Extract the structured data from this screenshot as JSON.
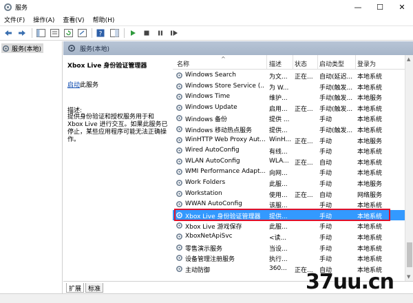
{
  "window": {
    "title": "服务",
    "minimize": "—",
    "maximize": "☐",
    "close": "✕"
  },
  "menu": [
    "文件(F)",
    "操作(A)",
    "查看(V)",
    "帮助(H)"
  ],
  "tree": {
    "root": "服务(本地)"
  },
  "header": {
    "title": "服务(本地)"
  },
  "details": {
    "service_name": "Xbox Live 身份验证管理器",
    "start_link": "启动",
    "start_suffix": "此服务",
    "desc_label": "描述:",
    "desc_text": "提供身份验证和授权服务用于和 Xbox Live 进行交互。如果此服务已停止，某些应用程序可能无法正确操作。"
  },
  "columns": {
    "name": "名称",
    "desc": "描述",
    "status": "状态",
    "startup": "启动类型",
    "logon": "登录为",
    "sort": "^"
  },
  "rows": [
    {
      "name": "Windows Search",
      "desc": "为文...",
      "status": "正在...",
      "startup": "自动(延迟...",
      "logon": "本地系统"
    },
    {
      "name": "Windows Store Service (...",
      "desc": "为 W...",
      "status": "",
      "startup": "手动(触发...",
      "logon": "本地系统"
    },
    {
      "name": "Windows Time",
      "desc": "维护...",
      "status": "",
      "startup": "手动(触发...",
      "logon": "本地服务"
    },
    {
      "name": "Windows Update",
      "desc": "启用...",
      "status": "正在...",
      "startup": "手动(触发...",
      "logon": "本地系统"
    },
    {
      "name": "Windows 备份",
      "desc": "提供 ...",
      "status": "",
      "startup": "手动",
      "logon": "本地系统"
    },
    {
      "name": "Windows 移动热点服务",
      "desc": "提供...",
      "status": "",
      "startup": "手动(触发...",
      "logon": "本地系统"
    },
    {
      "name": "WinHTTP Web Proxy Aut...",
      "desc": "WinH...",
      "status": "正在...",
      "startup": "手动",
      "logon": "本地服务"
    },
    {
      "name": "Wired AutoConfig",
      "desc": "有线...",
      "status": "",
      "startup": "手动",
      "logon": "本地系统"
    },
    {
      "name": "WLAN AutoConfig",
      "desc": "WLA...",
      "status": "正在...",
      "startup": "自动",
      "logon": "本地系统"
    },
    {
      "name": "WMI Performance Adapt...",
      "desc": "向网...",
      "status": "",
      "startup": "手动",
      "logon": "本地系统"
    },
    {
      "name": "Work Folders",
      "desc": "此服...",
      "status": "",
      "startup": "手动",
      "logon": "本地服务"
    },
    {
      "name": "Workstation",
      "desc": "使用...",
      "status": "正在...",
      "startup": "自动",
      "logon": "网络服务"
    },
    {
      "name": "WWAN AutoConfig",
      "desc": "该服...",
      "status": "",
      "startup": "手动",
      "logon": "本地系统"
    },
    {
      "name": "Xbox Live 身份验证管理器",
      "desc": "提供...",
      "status": "",
      "startup": "手动",
      "logon": "本地系统"
    },
    {
      "name": "Xbox Live 游戏保存",
      "desc": "此服...",
      "status": "",
      "startup": "手动",
      "logon": "本地系统"
    },
    {
      "name": "XboxNetApiSvc",
      "desc": "<读...",
      "status": "",
      "startup": "手动",
      "logon": "本地系统"
    },
    {
      "name": "零售演示服务",
      "desc": "当设...",
      "status": "",
      "startup": "手动",
      "logon": "本地系统"
    },
    {
      "name": "设备管理注册服务",
      "desc": "执行...",
      "status": "",
      "startup": "手动",
      "logon": "本地系统"
    },
    {
      "name": "主动防御",
      "desc": "360...",
      "status": "正在...",
      "startup": "自动",
      "logon": "本地系统"
    }
  ],
  "selected_row": 13,
  "tabs": [
    "扩展",
    "标准"
  ],
  "watermark": "37uu.cn",
  "colors": {
    "selection": "#3399ff",
    "highlight_border": "#e0102a",
    "header_band": "#b8c5d6",
    "link": "#0645ad"
  }
}
